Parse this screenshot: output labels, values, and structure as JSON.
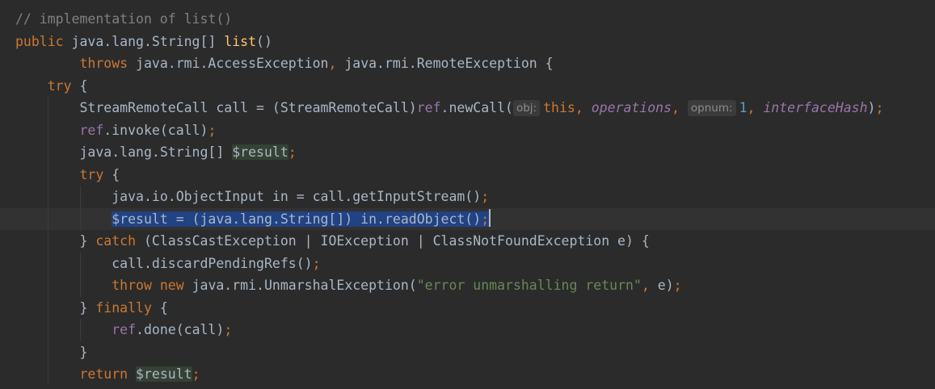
{
  "editor": {
    "lines": {
      "l0": {
        "comment": "// implementation of list()"
      },
      "l1": {
        "kw_public": "public",
        "type": " java.lang.String[] ",
        "method": "list",
        "parens": "()"
      },
      "l2": {
        "indent": "        ",
        "kw_throws": "throws",
        "ex1": " java.rmi.AccessException",
        "comma": ",",
        "ex2": " java.rmi.RemoteException {"
      },
      "l3": {
        "indent": "    ",
        "kw_try": "try",
        "brace": " {"
      },
      "l4": {
        "indent": "        ",
        "decl": "StreamRemoteCall call = (StreamRemoteCall)",
        "ref": "ref",
        "call": ".newCall(",
        "hint1": "obj:",
        "arg_this": "this",
        "comma1": ",",
        "space1": " ",
        "arg_ops": "operations",
        "comma2": ",",
        "space2": " ",
        "hint2": "opnum:",
        "arg_num": "1",
        "comma3": ",",
        "space3": " ",
        "arg_hash": "interfaceHash",
        "close": ")",
        "semi": ";"
      },
      "l5": {
        "indent": "        ",
        "ref": "ref",
        "rest": ".invoke(call)",
        "semi": ";"
      },
      "l6": {
        "indent": "        ",
        "type": "java.lang.String[] ",
        "var": "$result",
        "semi": ";"
      },
      "l7": {
        "indent": "        ",
        "kw_try": "try",
        "brace": " {"
      },
      "l8": {
        "indent": "            ",
        "code": "java.io.ObjectInput in = call.getInputStream()",
        "semi": ";"
      },
      "l9": {
        "indent": "            ",
        "selected": "$result = (java.lang.String[]) in.readObject()",
        "semi": ";"
      },
      "l10": {
        "indent": "        ",
        "brace": "} ",
        "kw_catch": "catch",
        "rest": " (ClassCastException | IOException | ClassNotFoundException e) {"
      },
      "l11": {
        "indent": "            ",
        "code": "call.discardPendingRefs()",
        "semi": ";"
      },
      "l12": {
        "indent": "            ",
        "kw_throw": "throw",
        "space": " ",
        "kw_new": "new",
        "ctor": " java.rmi.UnmarshalException(",
        "str": "\"error unmarshalling return\"",
        "comma": ",",
        "rest": " e)",
        "semi": ";"
      },
      "l13": {
        "indent": "        ",
        "brace": "} ",
        "kw_finally": "finally",
        "rest": " {"
      },
      "l14": {
        "indent": "            ",
        "ref": "ref",
        "rest": ".done(call)",
        "semi": ";"
      },
      "l15": {
        "indent": "        ",
        "brace": "}"
      },
      "l16": {
        "indent": "        ",
        "kw_return": "return",
        "space": " ",
        "var": "$result",
        "semi": ";"
      }
    }
  },
  "colors": {
    "background": "#2b2b2b",
    "keyword": "#cc7832",
    "method": "#ffc66d",
    "field": "#9876aa",
    "number": "#6897bb",
    "string": "#6a8759",
    "comment": "#808080",
    "selection": "#214283"
  }
}
